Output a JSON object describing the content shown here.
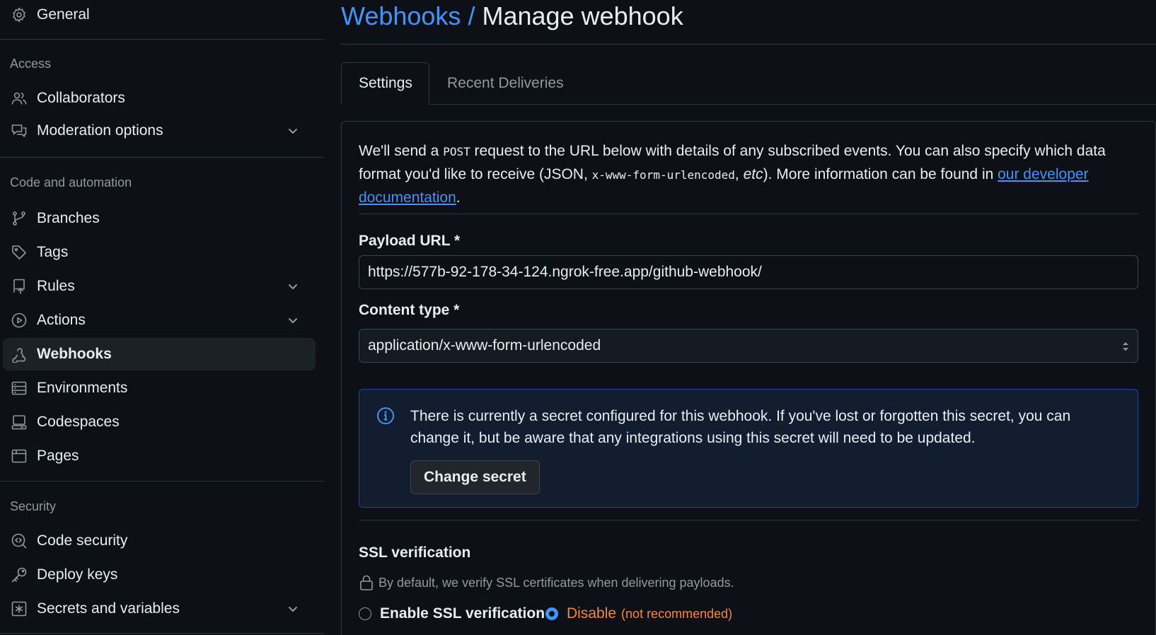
{
  "sidebar": {
    "general": "General",
    "access_heading": "Access",
    "collaborators": "Collaborators",
    "moderation": "Moderation options",
    "code_heading": "Code and automation",
    "branches": "Branches",
    "tags": "Tags",
    "rules": "Rules",
    "actions": "Actions",
    "webhooks": "Webhooks",
    "environments": "Environments",
    "codespaces": "Codespaces",
    "pages": "Pages",
    "security_heading": "Security",
    "code_security": "Code security",
    "deploy_keys": "Deploy keys",
    "secrets": "Secrets and variables"
  },
  "header": {
    "crumb": "Webhooks",
    "separator": "/",
    "title": "Manage webhook"
  },
  "tabs": {
    "settings": "Settings",
    "recent": "Recent Deliveries"
  },
  "intro": {
    "p1": "We'll send a ",
    "post": "POST",
    "p2": " request to the URL below with details of any subscribed events. You can also specify which data format you'd like to receive (JSON, ",
    "code": "x-www-form-urlencoded",
    "p3": ", ",
    "etc": "etc",
    "p4": "). More information can be found in ",
    "link": "our developer documentation",
    "p5": "."
  },
  "payload": {
    "label": "Payload URL *",
    "value": "https://577b-92-178-34-124.ngrok-free.app/github-webhook/"
  },
  "content_type": {
    "label": "Content type *",
    "value": "application/x-www-form-urlencoded"
  },
  "secret": {
    "message": "There is currently a secret configured for this webhook. If you've lost or forgotten this secret, you can change it, but be aware that any integrations using this secret will need to be updated.",
    "button": "Change secret"
  },
  "ssl": {
    "title": "SSL verification",
    "desc": "By default, we verify SSL certificates when delivering payloads.",
    "enable": "Enable SSL verification",
    "disable": "Disable",
    "not_recommended": "(not recommended)",
    "selected": "disable"
  },
  "colors": {
    "accent": "#4493f8",
    "danger": "#f0883e",
    "background": "#0d1117"
  }
}
